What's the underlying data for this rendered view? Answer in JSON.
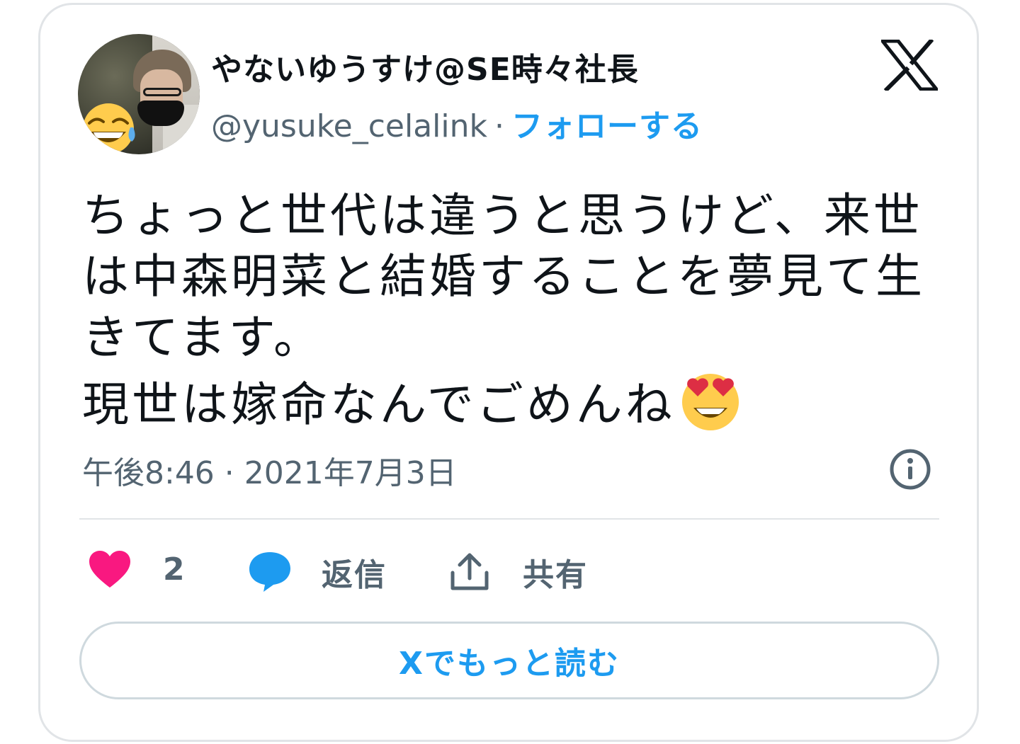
{
  "author": {
    "display_name": "やないゆうすけ@SE時々社長",
    "handle": "@yusuke_celalink",
    "separator": "·",
    "follow_label": "フォローする",
    "avatar_icon": "avatar-photo-with-laughing-emoji"
  },
  "tweet": {
    "lines": [
      "ちょっと世代は違うと思うけど、来世",
      "は中森明菜と結婚することを夢見て生",
      "きてます。",
      "現世は嫁命なんでごめんね"
    ],
    "trailing_emoji": "smiling-face-with-heart-eyes"
  },
  "meta": {
    "timestamp": "午後8:46 · 2021年7月3日"
  },
  "actions": {
    "like_count": "2",
    "reply_label": "返信",
    "share_label": "共有"
  },
  "footer": {
    "read_more_label": "Xでもっと読む"
  },
  "colors": {
    "accent": "#1d9bf0",
    "like": "#f91880",
    "muted": "#536471",
    "border": "#e1e4e7"
  }
}
